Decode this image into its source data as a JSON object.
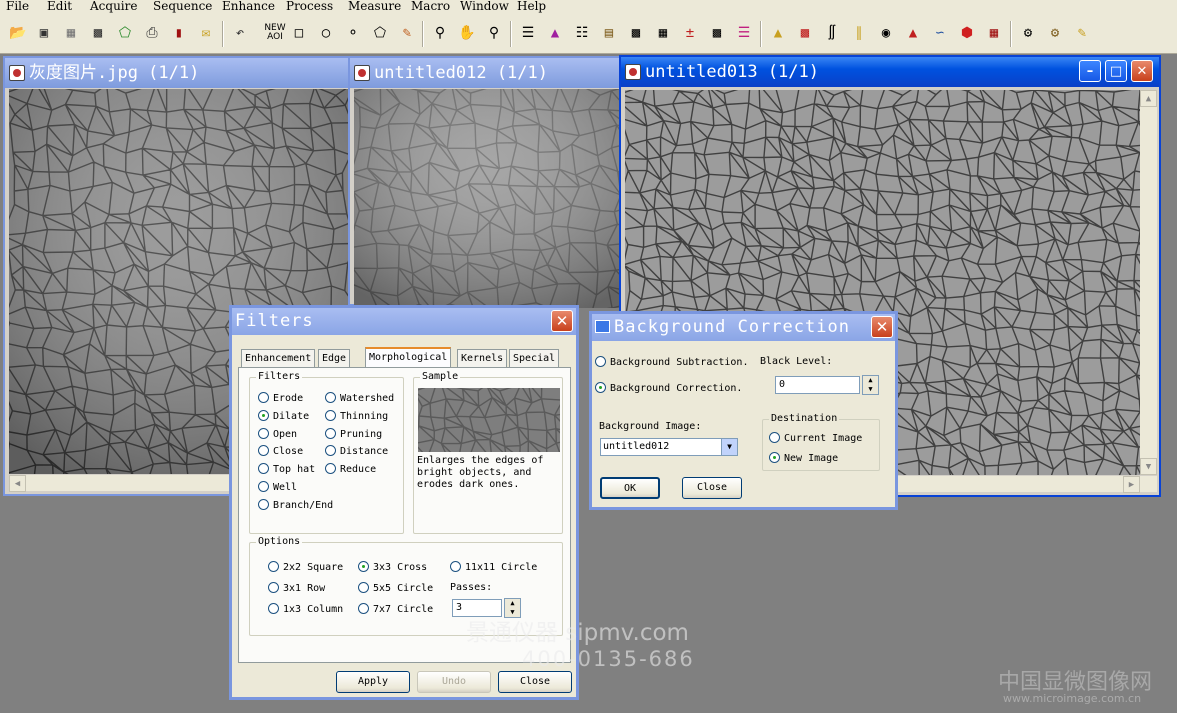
{
  "menubar": {
    "items": [
      "File",
      "Edit",
      "Acquire",
      "Sequence",
      "Enhance",
      "Process",
      "Measure",
      "Macro",
      "Window",
      "Help"
    ]
  },
  "toolbar": {
    "new_aoi_label": "NEW AOI",
    "icons": [
      "open-icon",
      "save-icon",
      "grid-icon",
      "camera-icon",
      "select-icon",
      "print-icon",
      "book-icon",
      "mail-icon",
      "undo-icon",
      "rect-aoi-icon",
      "ellipse-aoi-icon",
      "freehand-aoi-icon",
      "polygon-aoi-icon",
      "pencil-icon",
      "zoom-icon",
      "hand-icon",
      "zoom-fit-icon",
      "histogram-icon",
      "line-profile-icon",
      "bars-icon",
      "layers-icon",
      "grid-pattern-icon",
      "checker-icon",
      "math-icon",
      "tiles-icon",
      "palette-icon",
      "binary-icon",
      "colorize-icon",
      "measure-icon",
      "calibrate-icon",
      "camera-capture-icon",
      "spectrum-icon",
      "plot-icon",
      "3d-cube-icon",
      "report-icon",
      "macro-icon",
      "script-icon",
      "wand-icon"
    ]
  },
  "windows": {
    "win1": {
      "title": "灰度图片.jpg (1/1)"
    },
    "win2": {
      "title": "untitled012 (1/1)"
    },
    "win3": {
      "title": "untitled013 (1/1)"
    }
  },
  "filters": {
    "title": "Filters",
    "tabs": [
      "Enhancement",
      "Edge",
      "Morphological",
      "Kernels",
      "Special"
    ],
    "selected_tab": "Morphological",
    "filters_group": "Filters",
    "left_options": [
      "Erode",
      "Dilate",
      "Open",
      "Close",
      "Top hat",
      "Well",
      "Branch/End"
    ],
    "right_options": [
      "Watershed",
      "Thinning",
      "Pruning",
      "Distance",
      "Reduce"
    ],
    "selected_filter": "Dilate",
    "sample_group": "Sample",
    "sample_desc": "Enlarges the edges of bright objects, and erodes dark ones.",
    "options_group": "Options",
    "kernel_col1": [
      "2x2 Square",
      "3x1 Row",
      "1x3 Column"
    ],
    "kernel_col2": [
      "3x3 Cross",
      "5x5 Circle",
      "7x7 Circle"
    ],
    "kernel_col3": "11x11 Circle",
    "selected_kernel": "3x3 Cross",
    "passes_label": "Passes:",
    "passes_value": "3",
    "apply_label": "Apply",
    "undo_label": "Undo",
    "close_label": "Close"
  },
  "background": {
    "title": "Background Correction",
    "subtraction_label": "Background Subtraction.",
    "correction_label": "Background Correction.",
    "selected_mode": "Background Correction.",
    "black_level_label": "Black Level:",
    "black_level_value": "0",
    "bg_image_label": "Background Image:",
    "bg_image_value": "untitled012",
    "destination_label": "Destination",
    "current_image_label": "Current Image",
    "new_image_label": "New Image",
    "selected_destination": "New Image",
    "ok_label": "OK",
    "close_label": "Close"
  },
  "watermark": {
    "line1": "景通仪器 sipmv.com",
    "line2": "400-0135-686",
    "corner1": "中国显微图像网",
    "corner2": "www.microimage.com.cn"
  },
  "colors": {
    "titlebar_active": "#0a4fd9",
    "titlebar_inactive": "#8aa5e6",
    "face": "#ece9d8",
    "desktop": "#808080"
  }
}
